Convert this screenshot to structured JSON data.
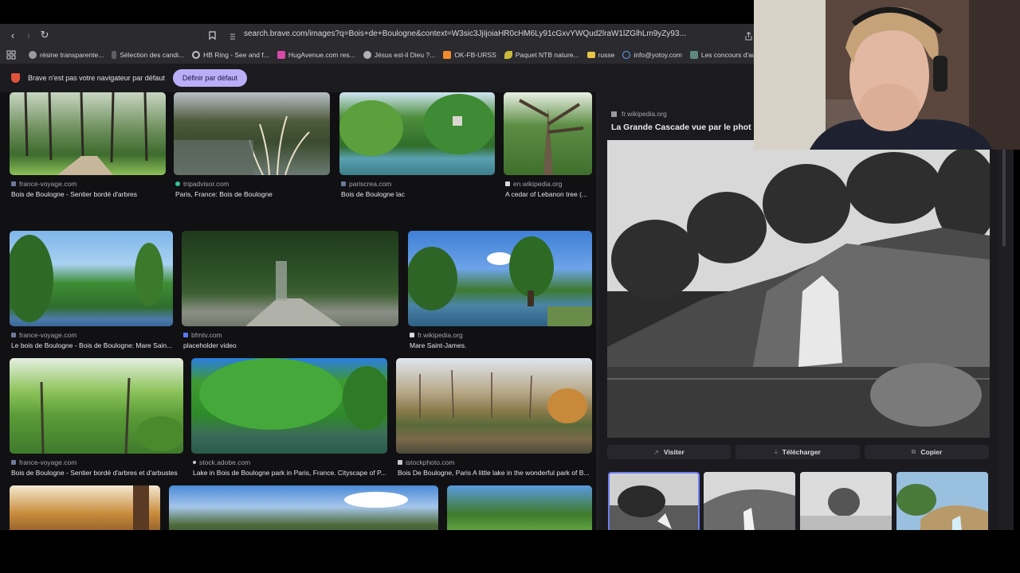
{
  "browser": {
    "url": "search.brave.com/images?q=Bois+de+Boulogne&context=W3sic3JjIjoiaHR0cHM6Ly91cGxvYWQud2lraW1lZGlhLm9yZy93aWtpcGVkaWEvY29tbW9ucy8...",
    "url_display": "search.brave.com/images?q=Bois+de+Boulogne&context=W3sic3JjIjoiaHR0cHM6Ly91cGxvYWQud2lraW1lZGlhLm9yZy93...",
    "bookmarks": [
      {
        "label": "résine transparente...",
        "icon": "circle-icon",
        "color": "#9a9aa3"
      },
      {
        "label": "Sélection des candi...",
        "icon": "doc-icon",
        "color": "#7a7a83"
      },
      {
        "label": "HB Ring - See and f...",
        "icon": "ring-icon",
        "color": "#c0c0c8"
      },
      {
        "label": "HugAvenue.com res...",
        "icon": "heart-icon",
        "color": "#d94aa8"
      },
      {
        "label": "Jésus est-il Dieu ?...",
        "icon": "circle-icon",
        "color": "#b0b0b8"
      },
      {
        "label": "OK-FB-URSS",
        "icon": "ok-icon",
        "color": "#f08a2a"
      },
      {
        "label": "Paquet NTB nature...",
        "icon": "leaf-icon",
        "color": "#c9b83a"
      },
      {
        "label": "russe",
        "icon": "folder-icon",
        "color": "#e8c54a"
      },
      {
        "label": "info@yotoy.com",
        "icon": "mail-icon",
        "color": "#6aa6f0"
      },
      {
        "label": "Les concours d'aute...",
        "icon": "doc-icon",
        "color": "#5a8a7a"
      }
    ]
  },
  "banner": {
    "text": "Brave n'est pas votre navigateur par défaut",
    "button": "Définir par défaut"
  },
  "results": [
    {
      "source": "france-voyage.com",
      "title": "Bois de Boulogne - Sentier bordé d'arbres"
    },
    {
      "source": "tripadvisor.com",
      "title": "Paris, France: Bois de Boulogne"
    },
    {
      "source": "pariscrea.com",
      "title": "Bois de Boulogne lac"
    },
    {
      "source": "en.wikipedia.org",
      "title": "A cedar of Lebanon tree (..."
    },
    {
      "source": "france-voyage.com",
      "title": "Le bois de Boulogne - Bois de Boulogne: Mare Sain..."
    },
    {
      "source": "bfmtv.com",
      "title": "placeholder video"
    },
    {
      "source": "fr.wikipedia.org",
      "title": "Mare Saint-James."
    },
    {
      "source": "france-voyage.com",
      "title": "Bois de Boulogne - Sentier bordé d'arbres et d'arbustes"
    },
    {
      "source": "stock.adobe.com",
      "title": "Lake in Bois de Boulogne park in Paris, France. Cityscape of P..."
    },
    {
      "source": "istockphoto.com",
      "title": "Bois De Boulogne, Paris A little lake in the wonderful park of B..."
    }
  ],
  "preview": {
    "source": "fr.wikipedia.org",
    "title": "La Grande Cascade vue par le phot",
    "buttons": {
      "visit": "Visiter",
      "download": "Télécharger",
      "copy": "Copier"
    }
  }
}
